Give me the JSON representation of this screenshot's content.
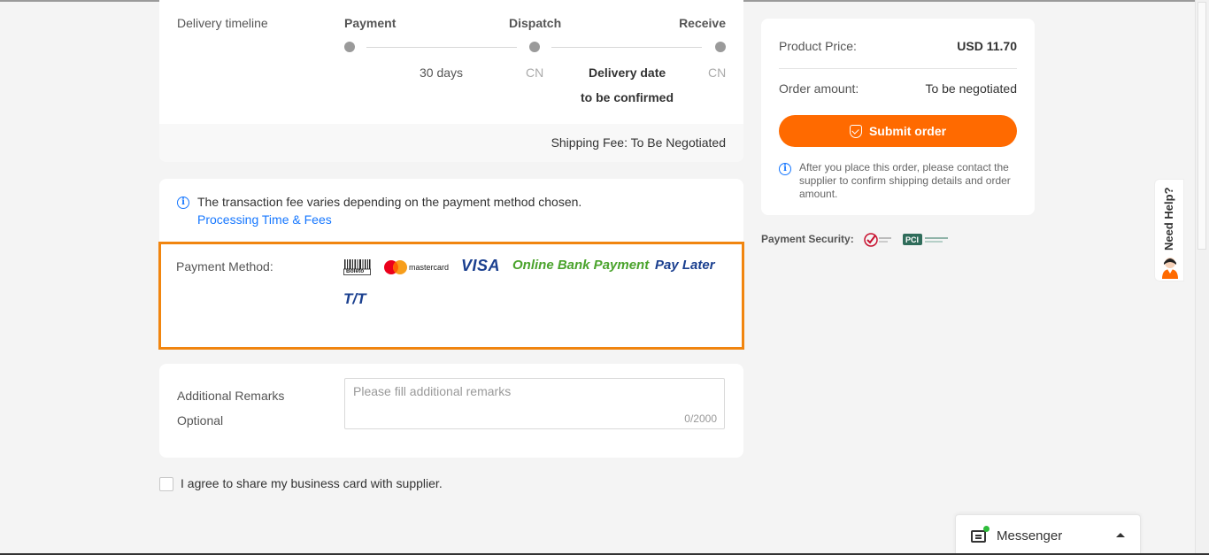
{
  "delivery": {
    "label": "Delivery timeline",
    "steps": [
      "Payment",
      "Dispatch",
      "Receive"
    ],
    "duration": "30 days",
    "origin_1": "CN",
    "origin_2": "CN",
    "delivery_date_line1": "Delivery date",
    "delivery_date_line2": "to be confirmed",
    "shipping_fee": "Shipping Fee:  To Be Negotiated"
  },
  "payment": {
    "fee_notice": "The transaction fee varies depending on the payment method chosen.",
    "fee_link": "Processing Time & Fees",
    "method_label": "Payment Method:",
    "methods": {
      "boleto": "Boleto",
      "mastercard": "mastercard",
      "visa": "VISA",
      "online_bank": "Online Bank Payment",
      "pay_later": "Pay Later",
      "tt": "T/T"
    }
  },
  "remarks": {
    "label_line1": "Additional Remarks",
    "label_line2": "Optional",
    "placeholder": "Please fill additional remarks",
    "counter": "0/2000"
  },
  "agree": {
    "text": "I agree to share my business card with supplier."
  },
  "summary": {
    "product_price_label": "Product Price:",
    "product_price_value": "USD 11.70",
    "order_amount_label": "Order amount:",
    "order_amount_value": "To be negotiated",
    "submit_label": "Submit order",
    "note": "After you place this order, please contact the supplier to confirm shipping details and order amount."
  },
  "security": {
    "label": "Payment Security:"
  },
  "help": {
    "label": "Need Help?"
  },
  "messenger": {
    "label": "Messenger"
  },
  "colors": {
    "accent": "#ff6a00",
    "highlight_border": "#f1850f",
    "link": "#1677ff",
    "online_bank": "#4aa32c",
    "visa": "#1a3f8f"
  }
}
